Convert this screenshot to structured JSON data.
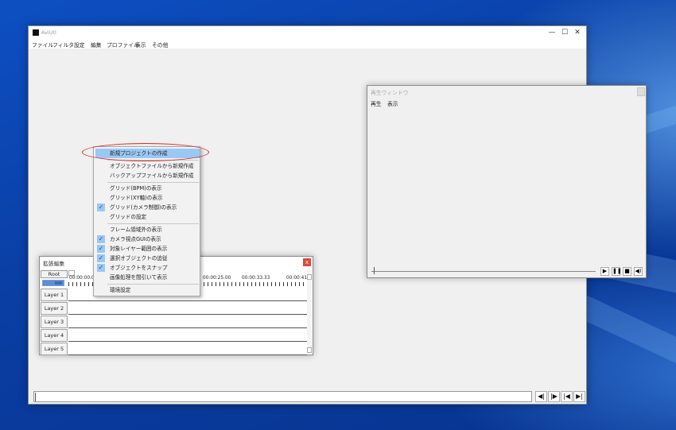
{
  "main_window": {
    "title": "AviUtl",
    "menu": [
      "ファイル",
      "フィルタ",
      "設定",
      "編集",
      "プロファイル",
      "表示",
      "その他"
    ],
    "controls": {
      "minimize": "—",
      "maximize": "☐",
      "close": "✕"
    },
    "bottom_buttons": [
      "◀|",
      "|▶",
      "|◀",
      "▶|"
    ]
  },
  "play_window": {
    "title": "再生ウィンドウ",
    "menu": [
      "再生",
      "表示"
    ],
    "buttons": [
      "▶",
      "❚❚",
      "■",
      "◀)"
    ]
  },
  "ext_window": {
    "title": "拡張編集",
    "close": "x",
    "root": "Root",
    "ruler_labels": [
      "00:00:00.00",
      "00:00:25.00",
      "00:00:33.33",
      "00:00:41"
    ],
    "layers": [
      "Layer 1",
      "Layer 2",
      "Layer 3",
      "Layer 4",
      "Layer 5"
    ]
  },
  "context_menu": {
    "items": [
      {
        "label": "新規プロジェクトの作成",
        "checked": false,
        "highlighted": true
      },
      {
        "label": "オブジェクトファイルから新規作成",
        "checked": false
      },
      {
        "label": "バックアップファイルから新規作成",
        "checked": false
      },
      {
        "label": "グリッド(BPM)の表示",
        "checked": false
      },
      {
        "label": "グリッド(XY軸)の表示",
        "checked": false
      },
      {
        "label": "グリッド(カメラ制御)の表示",
        "checked": true
      },
      {
        "label": "グリッドの設定",
        "checked": false
      },
      {
        "label": "フレーム領域外の表示",
        "checked": false
      },
      {
        "label": "カメラ視点GUIの表示",
        "checked": true
      },
      {
        "label": "対象レイヤー範囲の表示",
        "checked": true
      },
      {
        "label": "選択オブジェクトの追従",
        "checked": true
      },
      {
        "label": "オブジェクトをスナップ",
        "checked": true
      },
      {
        "label": "画像処理を間引いて表示",
        "checked": false
      },
      {
        "label": "環境設定",
        "checked": false
      }
    ]
  },
  "colors": {
    "highlight": "#9ac8f5",
    "annotation_circle": "#d9282a",
    "close_red": "#d94a3c"
  }
}
